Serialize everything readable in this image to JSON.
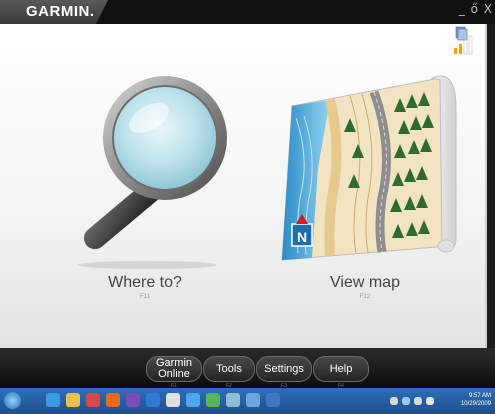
{
  "app": {
    "brand": "GARMIN.",
    "window_controls": "_ ő X"
  },
  "main": {
    "tiles": [
      {
        "label": "Where to?",
        "key": "F11"
      },
      {
        "label": "View map",
        "key": "F12"
      }
    ],
    "map_compass": "N"
  },
  "toolbar": {
    "buttons": [
      {
        "label": "Garmin Online",
        "key": "F1"
      },
      {
        "label": "Tools",
        "key": "F2"
      },
      {
        "label": "Settings",
        "key": "F3"
      },
      {
        "label": "Help",
        "key": "F4"
      }
    ]
  },
  "taskbar": {
    "clock_time": "9:57 AM",
    "clock_date": "10/29/2009"
  },
  "colors": {
    "signal": "#f5a200",
    "compass_arrow": "#d81c1c",
    "water": "#3aa6df",
    "forest": "#2f6b2e"
  }
}
